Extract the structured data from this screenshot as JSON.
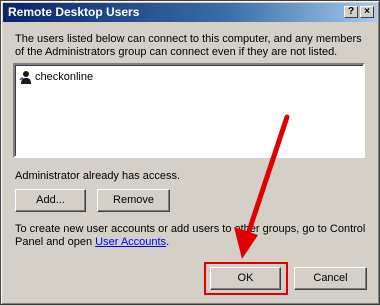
{
  "window": {
    "title": "Remote Desktop Users",
    "help_glyph": "?",
    "close_glyph": "×"
  },
  "description": "The users listed below can connect to this computer, and any members of the Administrators group can connect even if they are not listed.",
  "users": [
    {
      "name": "checkonline",
      "icon": "user-icon"
    }
  ],
  "admin_note": "Administrator already has access.",
  "buttons": {
    "add": "Add...",
    "remove": "Remove",
    "ok": "OK",
    "cancel": "Cancel"
  },
  "info": {
    "text_before": "To create new user accounts or add users to other groups, go to Control Panel and open ",
    "link": "User Accounts",
    "text_after": "."
  },
  "annotation": {
    "color": "#e00000",
    "target": "OK button"
  }
}
